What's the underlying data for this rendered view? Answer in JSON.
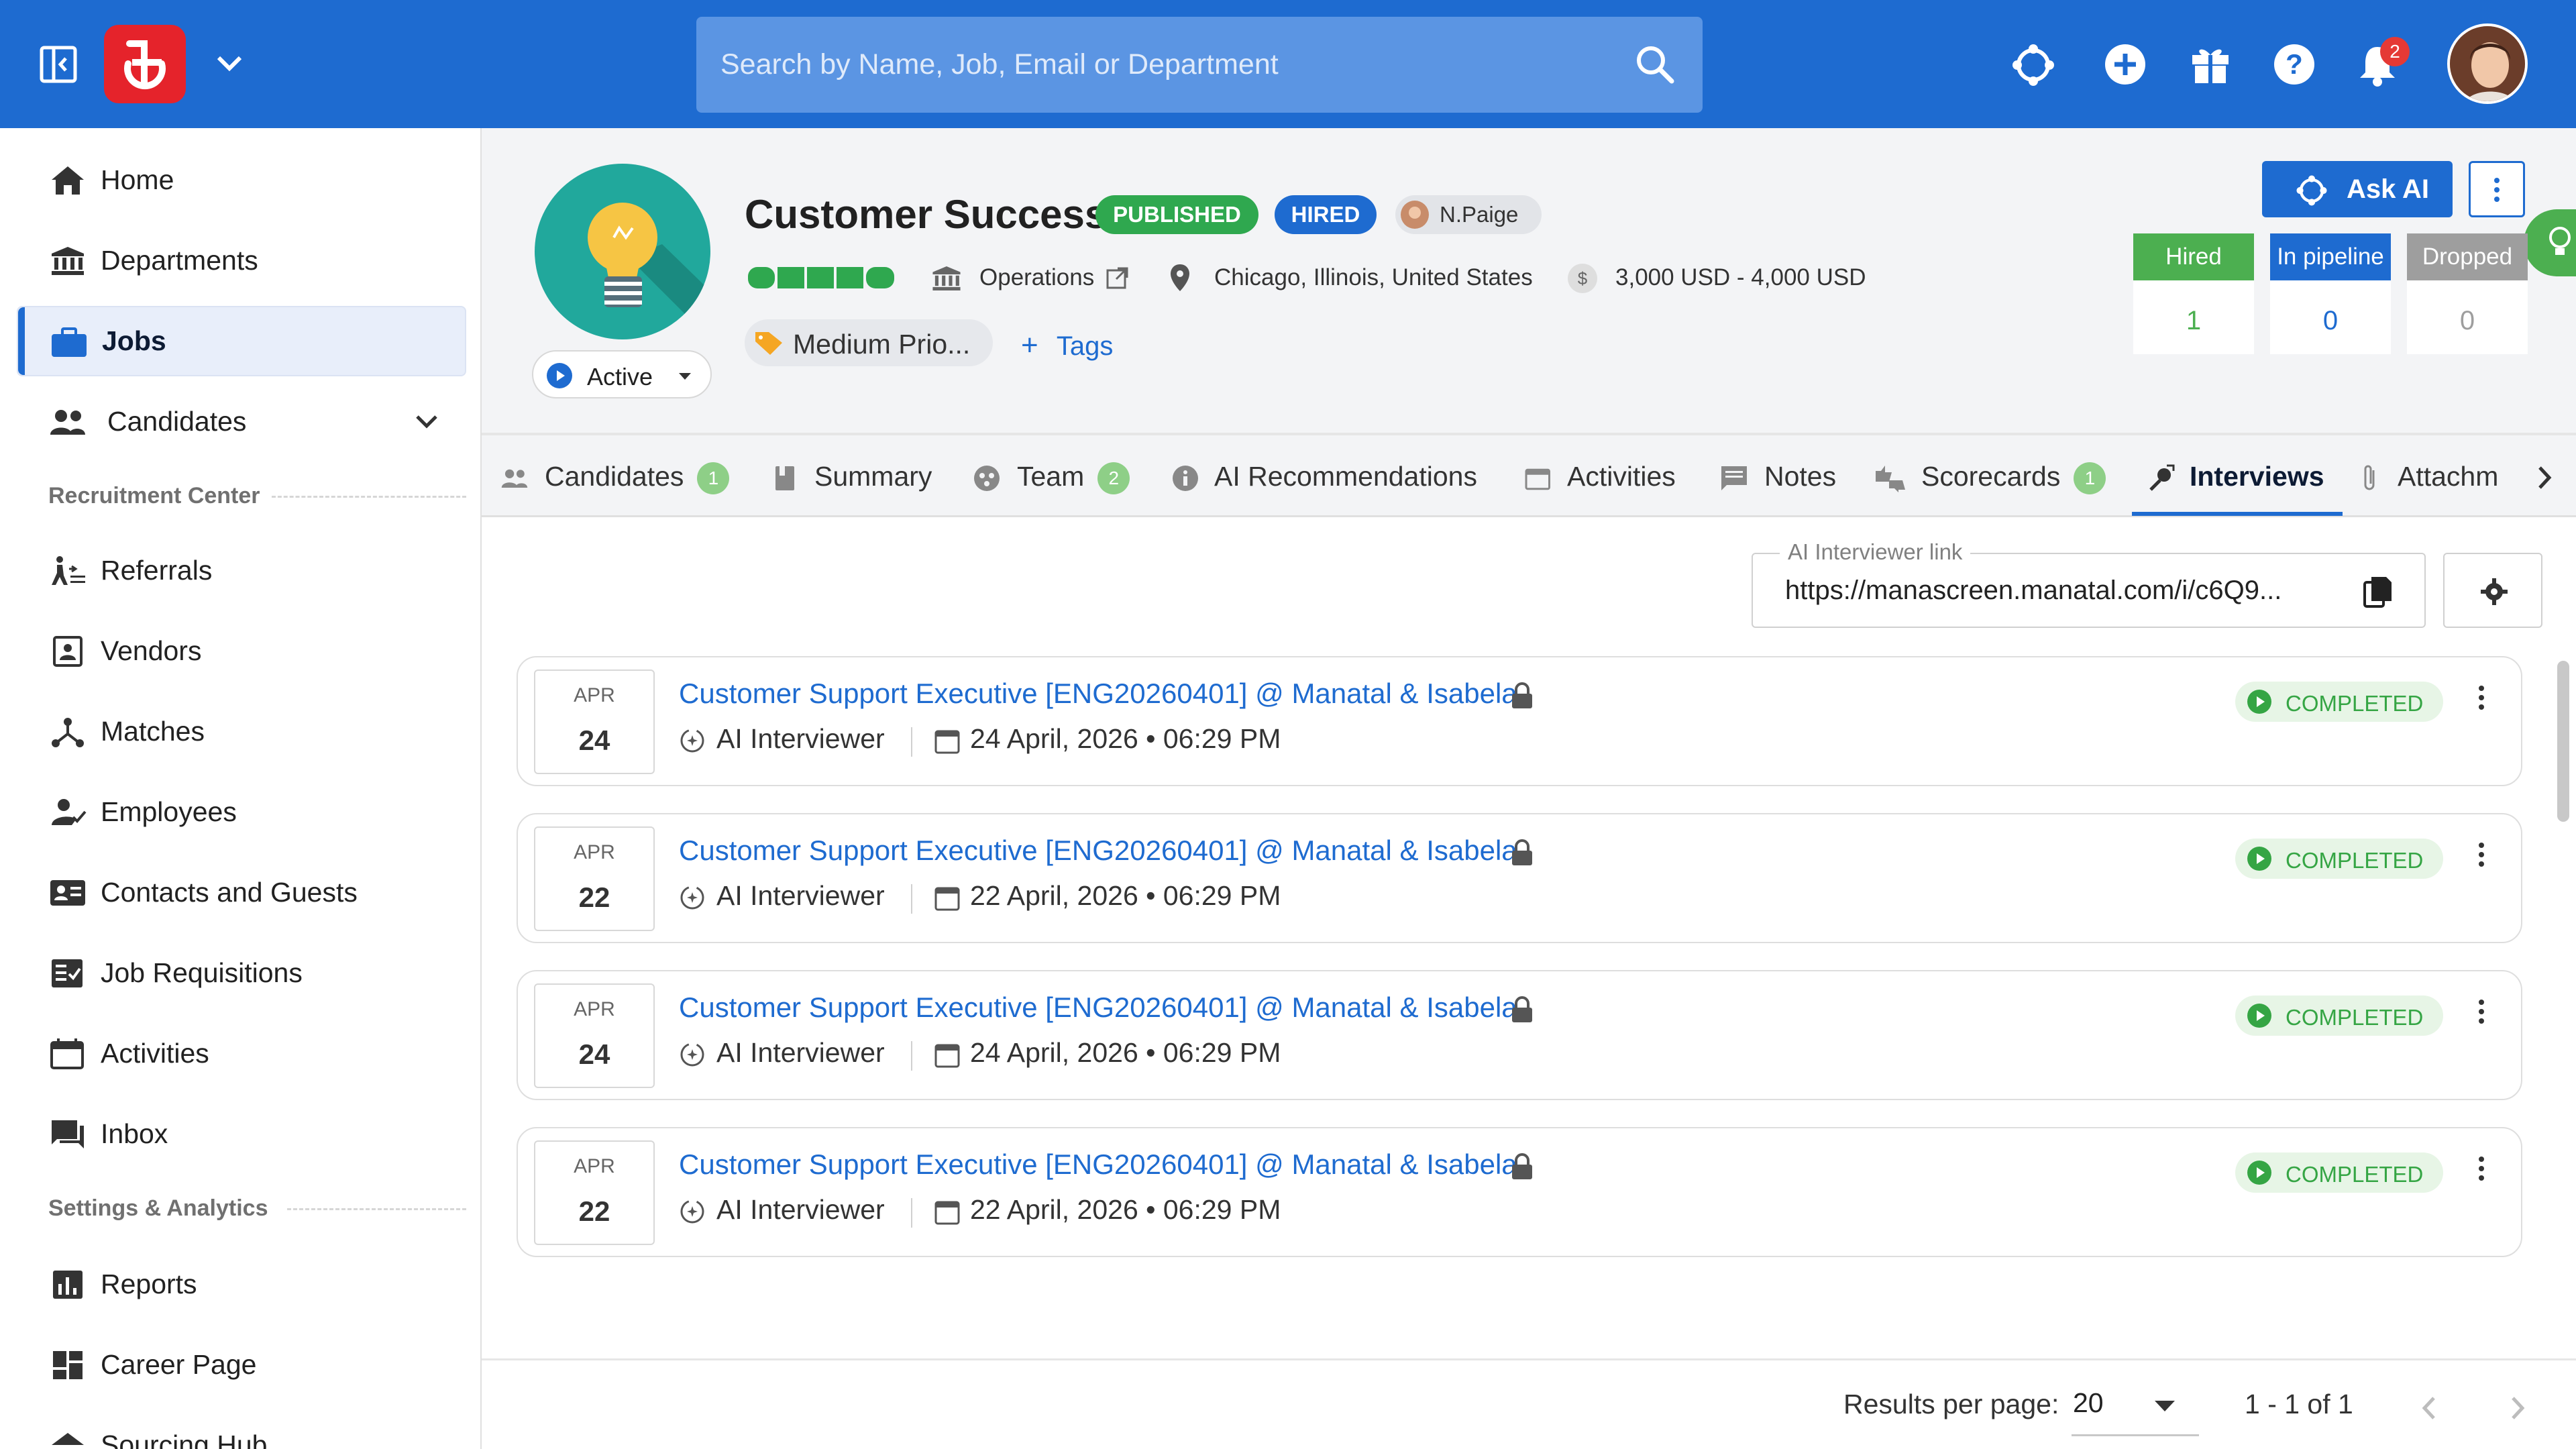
{
  "topbar": {
    "search_placeholder": "Search by Name, Job, Email or Department",
    "notification_count": "2"
  },
  "sidebar": {
    "items": [
      {
        "label": "Home"
      },
      {
        "label": "Departments"
      },
      {
        "label": "Jobs"
      },
      {
        "label": "Candidates"
      },
      {
        "label": "Referrals"
      },
      {
        "label": "Vendors"
      },
      {
        "label": "Matches"
      },
      {
        "label": "Employees"
      },
      {
        "label": "Contacts and Guests"
      },
      {
        "label": "Job Requisitions"
      },
      {
        "label": "Activities"
      },
      {
        "label": "Inbox"
      },
      {
        "label": "Reports"
      },
      {
        "label": "Career Page"
      },
      {
        "label": "Sourcing Hub"
      }
    ],
    "section_recruitment": "Recruitment Center",
    "section_settings": "Settings & Analytics"
  },
  "job": {
    "title": "Customer Success",
    "status_published": "PUBLISHED",
    "status_hired": "HIRED",
    "owner": "N.Paige",
    "department": "Operations",
    "location": "Chicago, Illinois, United States",
    "salary": "3,000 USD - 4,000 USD",
    "priority": "Medium Prio...",
    "tags_label": "Tags",
    "state": "Active",
    "ask_ai": "Ask AI",
    "stats": [
      {
        "label": "Hired",
        "value": "1",
        "color": "#4caf50"
      },
      {
        "label": "In pipeline",
        "value": "0",
        "color": "#1e6bd0"
      },
      {
        "label": "Dropped",
        "value": "0",
        "color": "#9e9e9e"
      }
    ]
  },
  "tabs": [
    {
      "label": "Candidates",
      "badge": "1"
    },
    {
      "label": "Summary"
    },
    {
      "label": "Team",
      "badge": "2"
    },
    {
      "label": "AI Recommendations"
    },
    {
      "label": "Activities"
    },
    {
      "label": "Notes"
    },
    {
      "label": "Scorecards",
      "badge": "1"
    },
    {
      "label": "Interviews"
    },
    {
      "label": "Attachm"
    }
  ],
  "interviewer_link": {
    "label": "AI Interviewer link",
    "value": "https://manascreen.manatal.com/i/c6Q9..."
  },
  "interviews": [
    {
      "month": "APR",
      "day": "24",
      "title": "Customer Support Executive [ENG20260401] @ Manatal & Isabela",
      "interviewer": "AI Interviewer",
      "datetime": "24 April, 2026 • 06:29 PM",
      "status": "COMPLETED"
    },
    {
      "month": "APR",
      "day": "22",
      "title": "Customer Support Executive [ENG20260401] @ Manatal & Isabela",
      "interviewer": "AI Interviewer",
      "datetime": "22 April, 2026 • 06:29 PM",
      "status": "COMPLETED"
    },
    {
      "month": "APR",
      "day": "24",
      "title": "Customer Support Executive [ENG20260401] @ Manatal & Isabela",
      "interviewer": "AI Interviewer",
      "datetime": "24 April, 2026 • 06:29 PM",
      "status": "COMPLETED"
    },
    {
      "month": "APR",
      "day": "22",
      "title": "Customer Support Executive [ENG20260401] @ Manatal & Isabela",
      "interviewer": "AI Interviewer",
      "datetime": "22 April, 2026 • 06:29 PM",
      "status": "COMPLETED"
    }
  ],
  "pagination": {
    "results_per_page_label": "Results per page:",
    "results_per_page": "20",
    "range": "1 - 1 of 1"
  }
}
